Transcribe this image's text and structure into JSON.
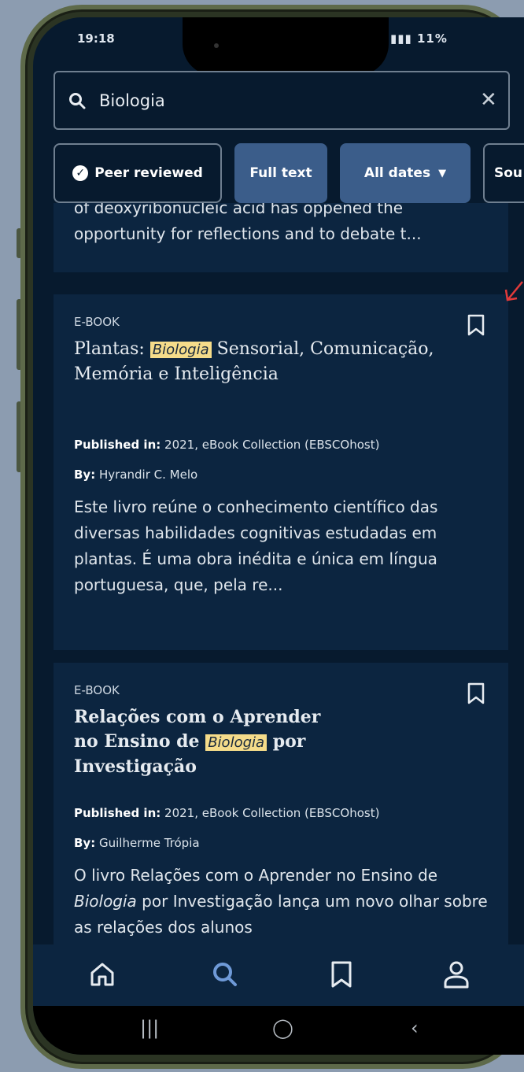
{
  "status_bar": {
    "time": "19:18",
    "battery": "11%"
  },
  "search": {
    "query": "Biologia"
  },
  "filters": [
    {
      "label": "Peer reviewed",
      "style": "outline",
      "check": true
    },
    {
      "label": "Full text",
      "style": "filled"
    },
    {
      "label": "All dates",
      "style": "filled",
      "dropdown": true
    },
    {
      "label": "Sou",
      "style": "outline"
    }
  ],
  "results": [
    {
      "description": "of deoxyribonucleic acid has oppened the opportunity for reflections and to debate t..."
    },
    {
      "type": "E-BOOK",
      "title_before": "Plantas: ",
      "title_highlight": "Biologia",
      "title_after": " Sensorial, Comunicação, Memória e Inteligência",
      "published_label": "Published in:",
      "published": "2021, eBook Collection (EBSCOhost)",
      "by_label": "By:",
      "author": "Hyrandir C. Melo",
      "description": "Este livro reúne o conhecimento científico das diversas habilidades cognitivas estudadas em plantas. É uma obra inédita e única em língua portuguesa, que, pela re..."
    },
    {
      "type": "E-BOOK",
      "title_before": "Relações com o Aprender no Ensino de ",
      "title_highlight": "Biologia",
      "title_after": " por Investigação",
      "published_label": "Published in:",
      "published": "2021, eBook Collection (EBSCOhost)",
      "by_label": "By:",
      "author": "Guilherme Trópia",
      "description_before": "O livro Relações com o Aprender no Ensino de ",
      "description_italic": "Biologia",
      "description_after": " por Investigação lança um novo olhar sobre as relações dos alunos"
    }
  ],
  "nav": [
    {
      "icon": "home-icon"
    },
    {
      "icon": "search-icon",
      "active": true
    },
    {
      "icon": "bookmark-icon"
    },
    {
      "icon": "profile-icon"
    }
  ],
  "colors": {
    "background": "#071a2e",
    "card": "#0c2540",
    "accent": "#3b5d8a",
    "highlight": "#f5dc8a",
    "annotation_arrow": "#e23a3a"
  }
}
